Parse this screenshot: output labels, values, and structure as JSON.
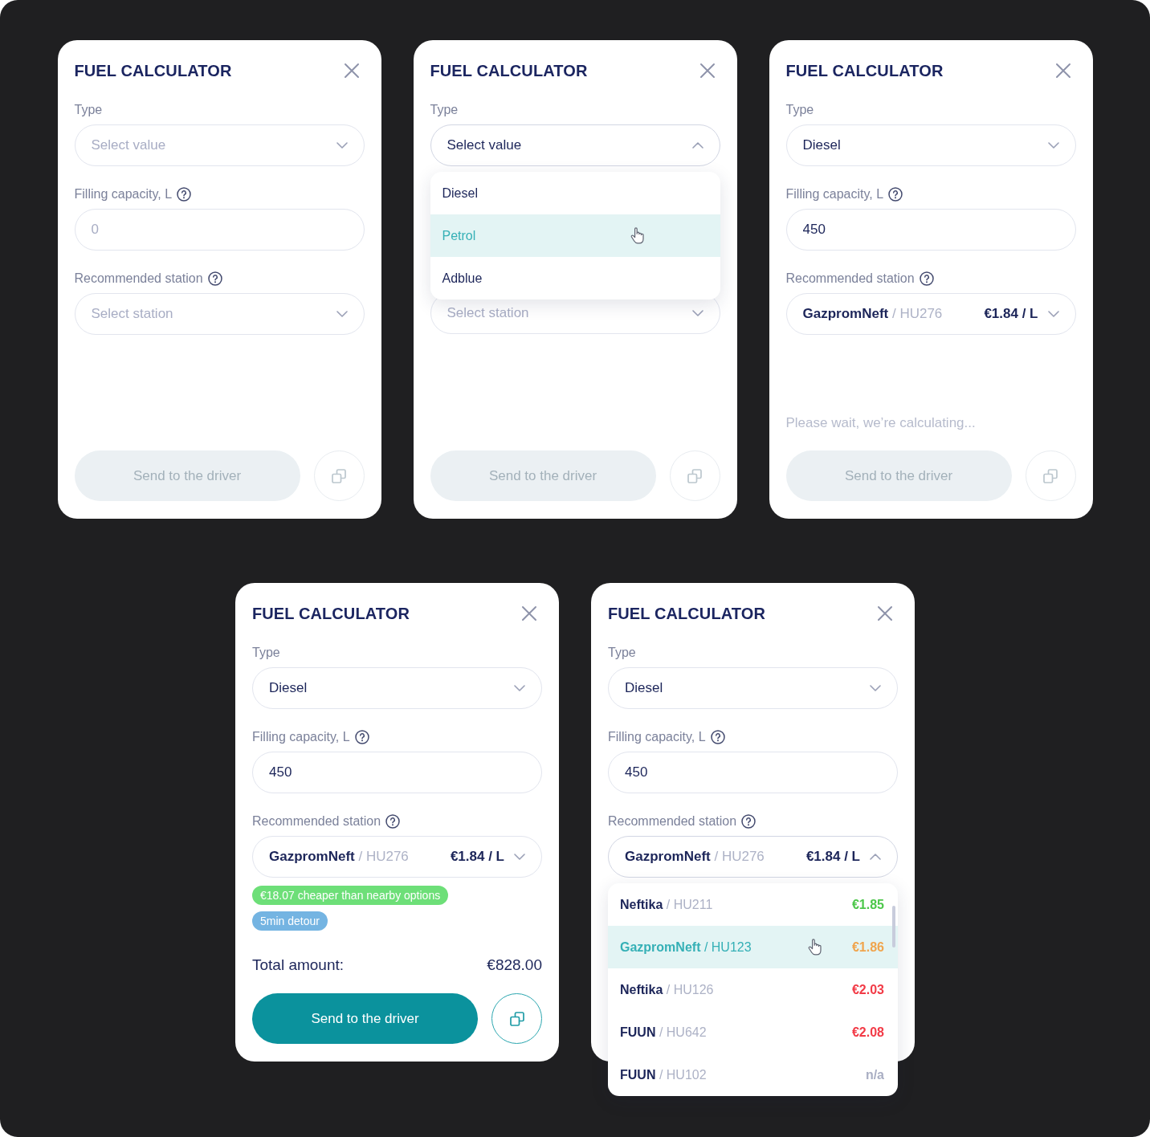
{
  "cards": [
    {
      "title": "FUEL CALCULATOR",
      "fields": [
        {
          "kind": "select",
          "label": "Type",
          "help": false,
          "placeholder": "Select value",
          "expanded": false
        },
        {
          "kind": "input",
          "label": "Filling capacity, L",
          "help": true,
          "placeholder": "0"
        },
        {
          "kind": "station",
          "label": "Recommended station",
          "help": true,
          "placeholder": "Select station",
          "expanded": false
        }
      ],
      "send_button": {
        "label": "Send to the driver",
        "disabled": true
      },
      "copy_button": {
        "disabled": true
      }
    },
    {
      "title": "FUEL CALCULATOR",
      "fields": [
        {
          "kind": "select",
          "label": "Type",
          "help": false,
          "placeholder": "Select value",
          "expanded": true,
          "options": [
            {
              "label": "Diesel",
              "selected": false
            },
            {
              "label": "Petrol",
              "selected": true
            },
            {
              "label": "Adblue",
              "selected": false
            }
          ]
        },
        {
          "kind": "station",
          "placeholder": "Select station",
          "expanded": false
        }
      ],
      "send_button": {
        "label": "Send to the driver",
        "disabled": true
      },
      "copy_button": {
        "disabled": true
      }
    },
    {
      "title": "FUEL CALCULATOR",
      "fields": [
        {
          "kind": "select",
          "label": "Type",
          "help": false,
          "value": "Diesel",
          "expanded": false
        },
        {
          "kind": "input",
          "label": "Filling capacity, L",
          "help": true,
          "value": "450"
        },
        {
          "kind": "station",
          "label": "Recommended station",
          "help": true,
          "value": {
            "station": "**GazpromNeft** / HU276",
            "price": "€1.84 / L"
          },
          "expanded": false
        }
      ],
      "status": "Please wait, we’re calculating...",
      "send_button": {
        "label": "Send to the driver",
        "disabled": true
      },
      "copy_button": {
        "disabled": true
      }
    },
    {
      "title": "FUEL CALCULATOR",
      "fields": [
        {
          "kind": "select",
          "label": "Type",
          "help": false,
          "value": "Diesel",
          "expanded": false
        },
        {
          "kind": "input",
          "label": "Filling capacity, L",
          "help": true,
          "value": "450"
        },
        {
          "kind": "station",
          "label": "Recommended station",
          "help": true,
          "value": {
            "station": "**GazpromNeft** / HU276",
            "price": "€1.84 / L"
          },
          "expanded": false
        }
      ],
      "tags": [
        {
          "text": "€18.07 cheaper than nearby options",
          "color": "#6ddf78"
        },
        {
          "text": "5min detour",
          "color": "#74b4e2"
        }
      ],
      "total": {
        "label": "Total amount:",
        "amount": "€828.00"
      },
      "send_button": {
        "label": "Send to the driver",
        "disabled": false
      },
      "copy_button": {
        "disabled": false
      }
    },
    {
      "title": "FUEL CALCULATOR",
      "fields": [
        {
          "kind": "select",
          "label": "Type",
          "help": false,
          "value": "Diesel",
          "expanded": false
        },
        {
          "kind": "input",
          "label": "Filling capacity, L",
          "help": true,
          "value": "450"
        },
        {
          "kind": "station",
          "label": "Recommended station",
          "help": true,
          "value": {
            "station": "**GazpromNeft** / HU276",
            "price": "€1.84 / L"
          },
          "expanded": true,
          "options": [
            {
              "station": "**Neftika** / HU211",
              "price": "€1.85",
              "color": "#4cc74a",
              "selected": false
            },
            {
              "station": "**GazpromNeft** / HU123",
              "price": "€1.86",
              "color": "#f0a54e",
              "selected": true
            },
            {
              "station": "**Neftika** / HU126",
              "price": "€2.03",
              "color": "#f23b47",
              "selected": false
            },
            {
              "station": "**FUUN** / HU642",
              "price": "€2.08",
              "color": "#f23b47",
              "selected": false
            },
            {
              "station": "**FUUN** / HU102",
              "price": "n/a",
              "color": "#a9aec3",
              "selected": false
            }
          ]
        }
      ]
    }
  ]
}
